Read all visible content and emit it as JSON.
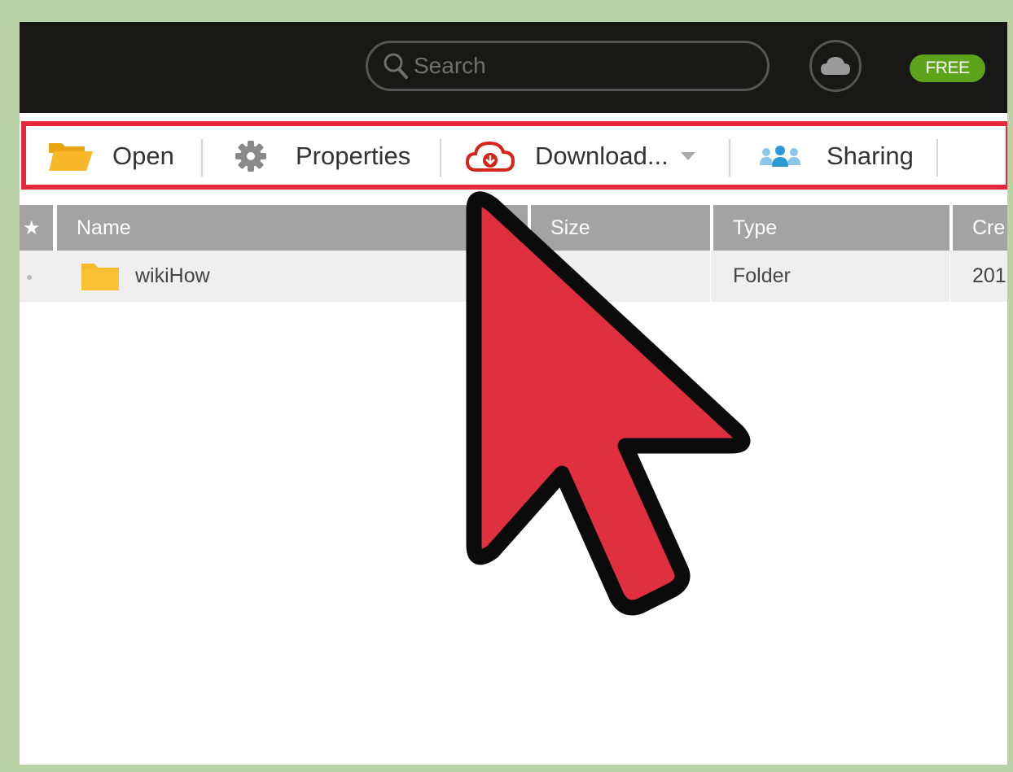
{
  "topbar": {
    "search_placeholder": "Search",
    "plan_badge": "FREE",
    "badge_color": "#5ea31c"
  },
  "toolbar": {
    "open_label": "Open",
    "properties_label": "Properties",
    "download_label": "Download...",
    "sharing_label": "Sharing",
    "highlight_color": "#e5283c"
  },
  "table": {
    "columns": [
      "★",
      "Name",
      "Size",
      "Type",
      "Cre"
    ],
    "rows": [
      {
        "name": "wikiHow",
        "size": "",
        "type": "Folder",
        "created": "201"
      }
    ]
  },
  "icons": {
    "search": "search-icon",
    "cloud": "cloud-icon",
    "open": "folder-open-icon",
    "properties": "gear-icon",
    "download": "cloud-download-icon",
    "dropdown": "caret-down-icon",
    "sharing": "people-icon",
    "folder": "folder-icon",
    "cursor": "mouse-pointer-icon"
  }
}
